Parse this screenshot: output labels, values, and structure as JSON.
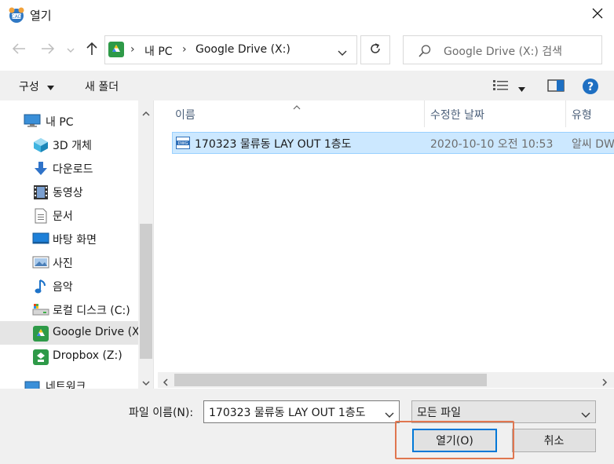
{
  "window": {
    "title": "열기"
  },
  "nav": {
    "breadcrumb": [
      "내 PC",
      "Google Drive (X:)"
    ],
    "sep": "›",
    "search_placeholder": "Google Drive (X:) 검색"
  },
  "toolbar": {
    "organize": "구성",
    "new_folder": "새 폴더"
  },
  "sidebar": {
    "items": [
      {
        "label": "내 PC",
        "icon": "pc-icon"
      },
      {
        "label": "3D 개체",
        "icon": "3d-objects-icon"
      },
      {
        "label": "다운로드",
        "icon": "download-icon"
      },
      {
        "label": "동영상",
        "icon": "video-icon"
      },
      {
        "label": "문서",
        "icon": "document-icon"
      },
      {
        "label": "바탕 화면",
        "icon": "desktop-icon"
      },
      {
        "label": "사진",
        "icon": "pictures-icon"
      },
      {
        "label": "음악",
        "icon": "music-icon"
      },
      {
        "label": "로컬 디스크 (C:)",
        "icon": "local-disk-icon"
      },
      {
        "label": "Google Drive (X",
        "icon": "google-drive-icon"
      },
      {
        "label": "Dropbox (Z:)",
        "icon": "dropbox-icon"
      },
      {
        "label": "네트워크",
        "icon": "network-icon"
      }
    ]
  },
  "columns": {
    "name": "이름",
    "date": "수정한 날짜",
    "type": "유형"
  },
  "files": [
    {
      "name": "170323 물류동 LAY OUT 1층도",
      "date": "2020-10-10 오전 10:53",
      "type": "알씨 DW"
    }
  ],
  "bottom": {
    "filename_label": "파일 이름(N):",
    "filename_value": "170323 물류동 LAY OUT 1층도",
    "filetype_value": "모든 파일",
    "open_label": "열기(O)",
    "cancel_label": "취소"
  },
  "colors": {
    "accent": "#0078d7",
    "selection": "#cce8ff",
    "highlight_box": "#e0764f",
    "help": "#1e6fc2"
  }
}
